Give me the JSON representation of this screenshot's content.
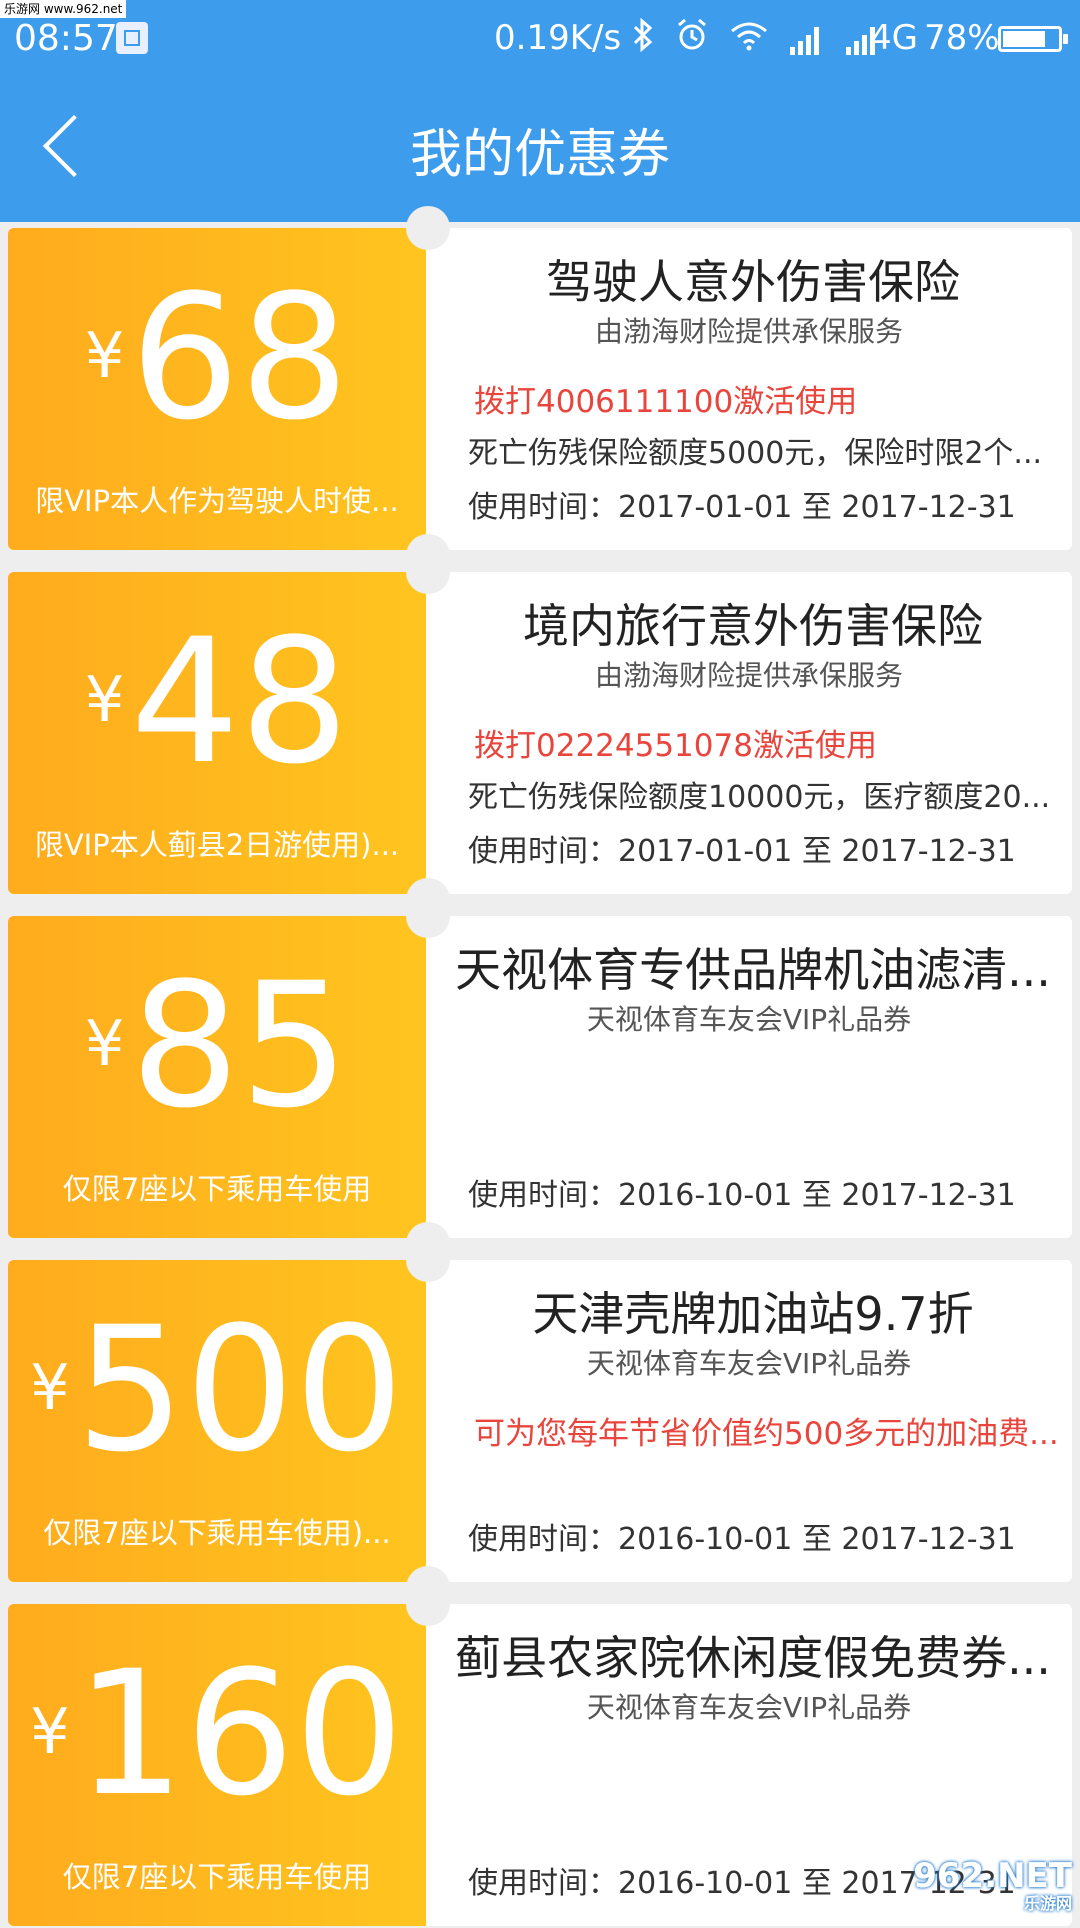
{
  "watermark_top": "乐游网 www.962.net",
  "status_bar": {
    "time": "08:57",
    "net_speed": "0.19K/s",
    "network": "4G",
    "battery": "78%",
    "battery_level": 0.78
  },
  "header": {
    "title": "我的优惠券"
  },
  "coupons": [
    {
      "currency": "¥",
      "amount": "68",
      "condition": "限VIP本人作为驾驶人时使...",
      "title": "驾驶人意外伤害保险",
      "subtitle": "由渤海财险提供承保服务",
      "highlight": "拨打4006111100激活使用",
      "description": "死亡伤残保险额度5000元，保险时限2个...",
      "valid_time": "使用时间：2017-01-01 至 2017-12-31"
    },
    {
      "currency": "¥",
      "amount": "48",
      "condition": "限VIP本人蓟县2日游使用)...",
      "title": "境内旅行意外伤害保险",
      "subtitle": "由渤海财险提供承保服务",
      "highlight": "拨打02224551078激活使用",
      "description": "死亡伤残保险额度10000元，医疗额度20...",
      "valid_time": "使用时间：2017-01-01 至 2017-12-31"
    },
    {
      "currency": "¥",
      "amount": "85",
      "condition": "仅限7座以下乘用车使用",
      "title": "天视体育专供品牌机油滤清...",
      "subtitle": "天视体育车友会VIP礼品券",
      "highlight": "",
      "description": "",
      "valid_time": "使用时间：2016-10-01 至 2017-12-31"
    },
    {
      "currency": "¥",
      "amount": "500",
      "condition": "仅限7座以下乘用车使用)...",
      "title": "天津壳牌加油站9.7折",
      "subtitle": "天视体育车友会VIP礼品券",
      "highlight": "可为您每年节省价值约500多元的加油费...",
      "description": "",
      "valid_time": "使用时间：2016-10-01 至 2017-12-31"
    },
    {
      "currency": "¥",
      "amount": "160",
      "condition": "仅限7座以下乘用车使用",
      "title": "蓟县农家院休闲度假免费券...",
      "subtitle": "天视体育车友会VIP礼品券",
      "highlight": "",
      "description": "",
      "valid_time": "使用时间：2016-10-01 至 2017-12-31"
    }
  ],
  "watermark_bottom": {
    "logo": "962.NET",
    "text": "乐游网"
  },
  "colors": {
    "header": "#3d9cec",
    "coupon_left_start": "#ffab1d",
    "coupon_left_end": "#ffc51f",
    "highlight_red": "#e8453c",
    "background": "#eeeeee"
  },
  "icons": [
    "back-icon",
    "screenshot-icon",
    "bluetooth-icon",
    "alarm-icon",
    "wifi-icon",
    "signal-icon",
    "battery-icon"
  ]
}
